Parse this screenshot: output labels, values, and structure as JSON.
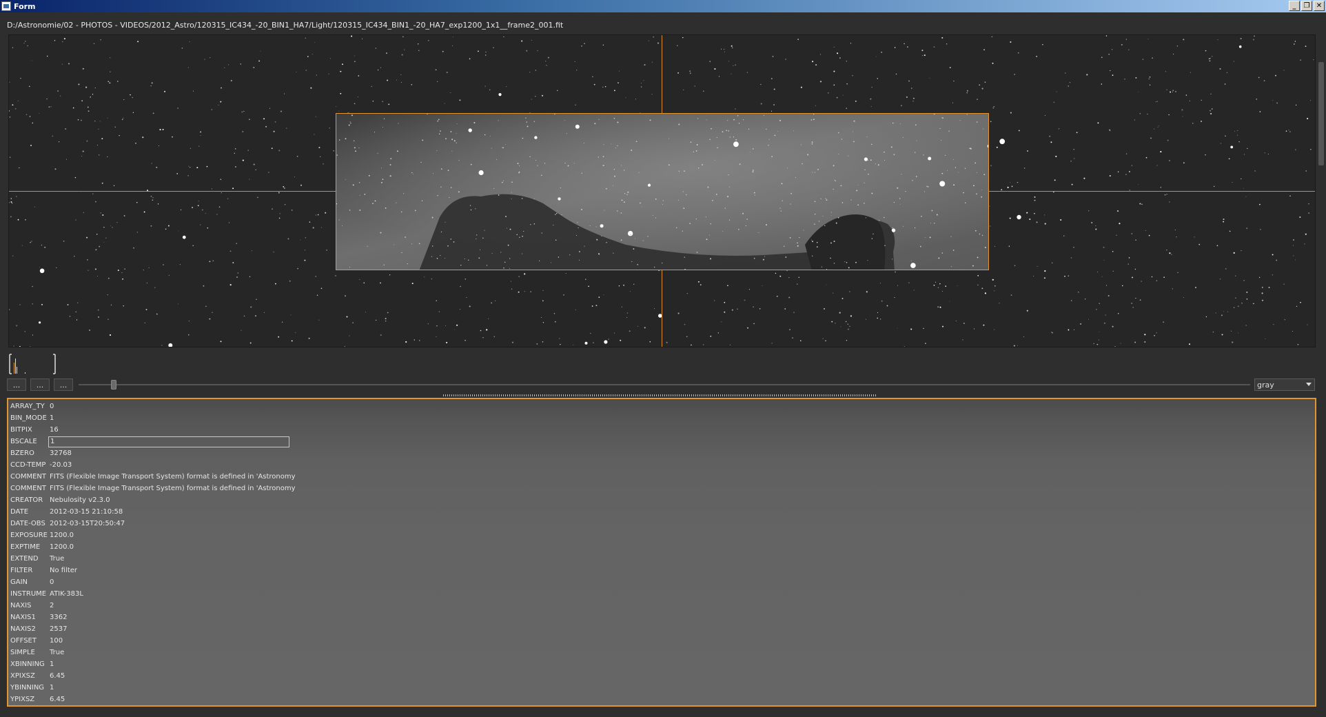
{
  "window": {
    "title": "Form",
    "min_label": "_",
    "max_label": "❐",
    "close_label": "✕"
  },
  "file_path": "D:/Astronomie/02 - PHOTOS - VIDEOS/2012_Astro/120315_IC434_-20_BIN1_HA7/Light/120315_IC434_BIN1_-20_HA7_exp1200_1x1__frame2_001.fit",
  "controls": {
    "button1": "...",
    "button2": "...",
    "button3": "...",
    "colormap": "gray",
    "slider_value": 0.03
  },
  "colors": {
    "accent": "#e5952f",
    "background": "#2e2e2e"
  },
  "header": [
    {
      "key": "ARRAY_TY",
      "value": "0"
    },
    {
      "key": "BIN_MODE",
      "value": "1"
    },
    {
      "key": "BITPIX",
      "value": "16"
    },
    {
      "key": "BSCALE",
      "value": "1"
    },
    {
      "key": "BZERO",
      "value": "32768"
    },
    {
      "key": "CCD-TEMP",
      "value": "-20.03"
    },
    {
      "key": "COMMENT",
      "value": " FITS (Flexible Image Transport System) format is defined in 'Astronomy"
    },
    {
      "key": "COMMENT",
      "value": " FITS (Flexible Image Transport System) format is defined in 'Astronomy"
    },
    {
      "key": "CREATOR",
      "value": "Nebulosity v2.3.0"
    },
    {
      "key": "DATE",
      "value": "2012-03-15 21:10:58"
    },
    {
      "key": "DATE-OBS",
      "value": "2012-03-15T20:50:47"
    },
    {
      "key": "EXPOSURE",
      "value": "1200.0"
    },
    {
      "key": "EXPTIME",
      "value": "1200.0"
    },
    {
      "key": "EXTEND",
      "value": "True"
    },
    {
      "key": "FILTER",
      "value": "No filter"
    },
    {
      "key": "GAIN",
      "value": "0"
    },
    {
      "key": "INSTRUME",
      "value": "ATIK-383L"
    },
    {
      "key": "NAXIS",
      "value": "2"
    },
    {
      "key": "NAXIS1",
      "value": "3362"
    },
    {
      "key": "NAXIS2",
      "value": "2537"
    },
    {
      "key": "OFFSET",
      "value": "100"
    },
    {
      "key": "SIMPLE",
      "value": "True"
    },
    {
      "key": "XBINNING",
      "value": "1"
    },
    {
      "key": "XPIXSZ",
      "value": "6.45"
    },
    {
      "key": "YBINNING",
      "value": "1"
    },
    {
      "key": "YPIXSZ",
      "value": "6.45"
    }
  ]
}
